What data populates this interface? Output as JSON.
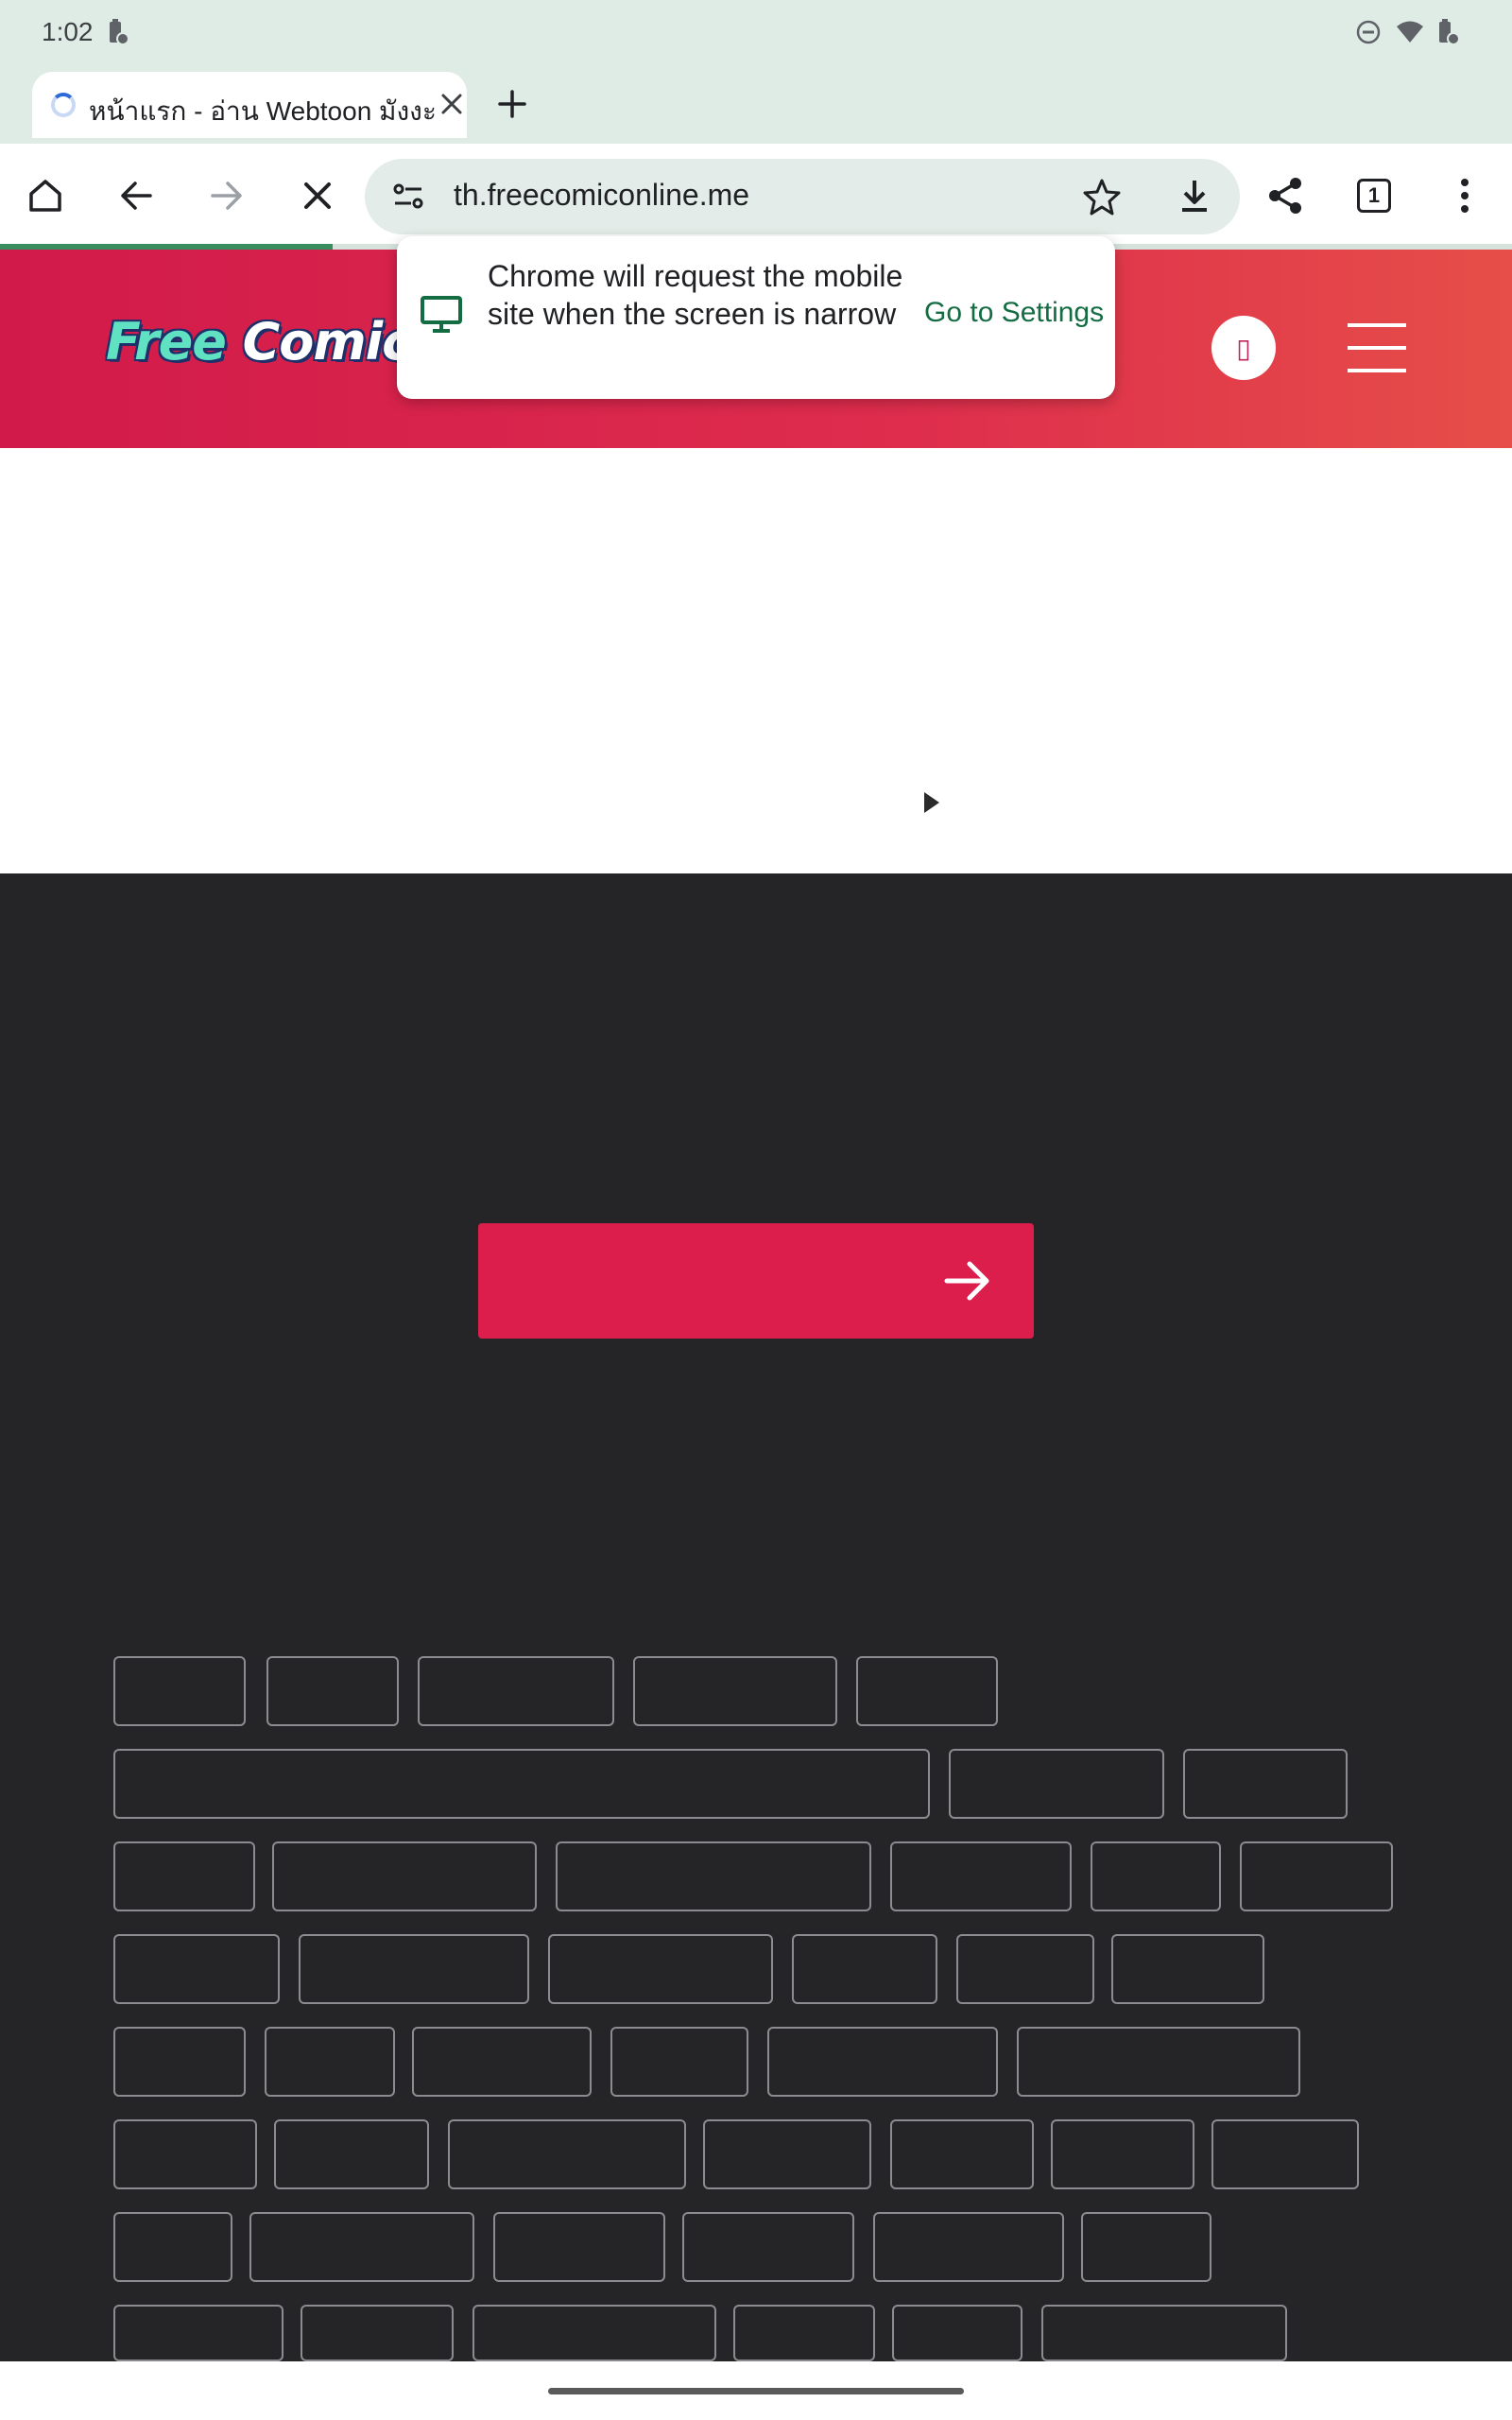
{
  "status_bar": {
    "time": "1:02",
    "icons": [
      "battery-saver-icon",
      "do-not-disturb-icon",
      "wifi-icon",
      "battery-icon"
    ]
  },
  "tab": {
    "title": "หน้าแรก - อ่าน Webtoon มังงะ",
    "close_icon": "close-icon",
    "new_tab_icon": "plus-icon"
  },
  "toolbar": {
    "icons": [
      "home-icon",
      "back-icon",
      "forward-icon",
      "stop-icon",
      "site-settings-icon",
      "bookmark-star-icon",
      "download-icon",
      "share-icon",
      "tab-count-icon",
      "more-menu-icon"
    ],
    "url": "th.freecomiconline.me",
    "tab_count": "1",
    "load_progress": 0.22
  },
  "site": {
    "logo_free": "Free",
    "logo_rest": "Comic O",
    "avatar_glyph": "▯",
    "colors": {
      "header_start": "#d21a4a",
      "header_end": "#e64e48",
      "cta": "#dc1e4c",
      "dark_bg": "#252527"
    }
  },
  "popup": {
    "message": "Chrome will request the mobile site when the screen is narrow",
    "link": "Go to Settings"
  },
  "tag_rows": 8
}
